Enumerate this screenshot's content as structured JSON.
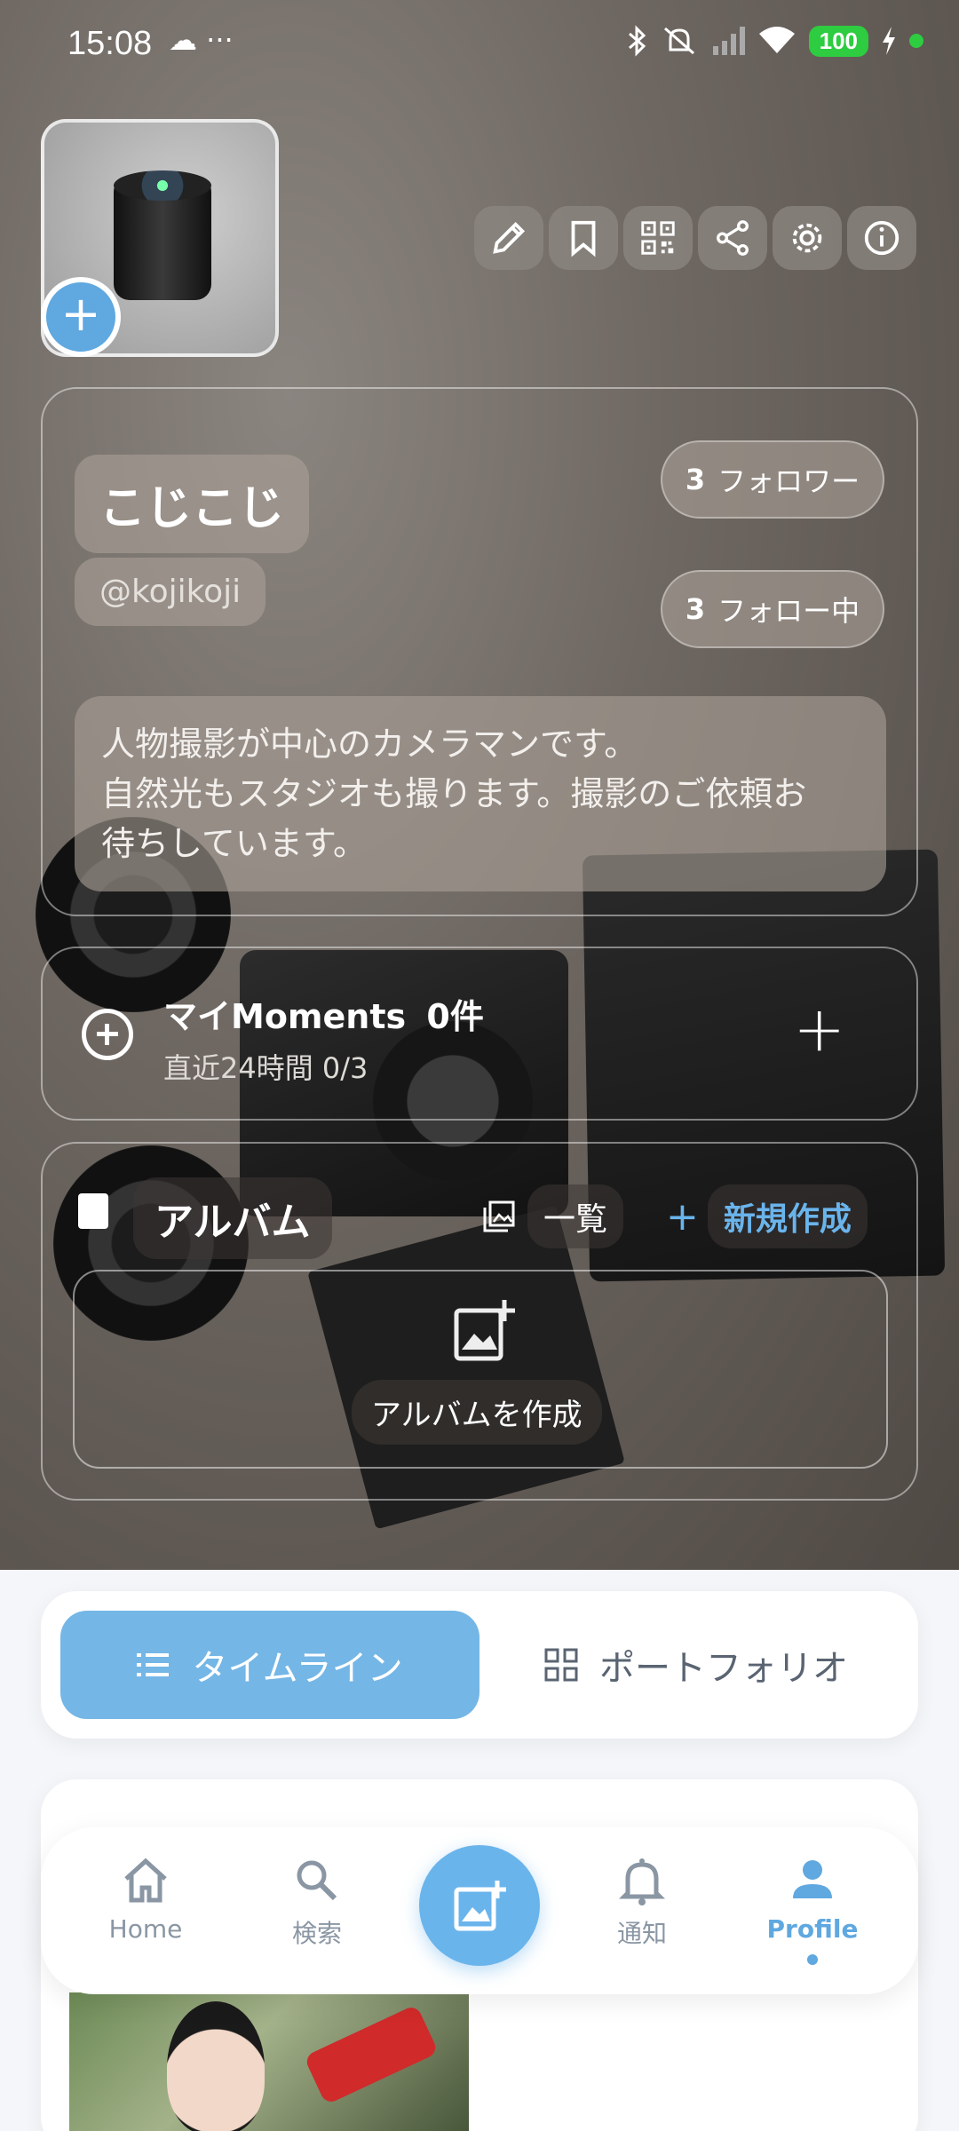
{
  "status_bar": {
    "time": "15:08",
    "left_icons": "☁ ···",
    "battery": "100",
    "icons": [
      "bluetooth-icon",
      "mute-icon",
      "signal-icon",
      "wifi-icon",
      "charging-icon"
    ]
  },
  "profile": {
    "display_name": "こじこじ",
    "handle": "@kojikoji",
    "followers_count": "3",
    "followers_label": "フォロワー",
    "following_count": "3",
    "following_label": "フォロー中",
    "bio_lines": [
      "人物撮影が中心のカメラマンです。",
      "自然光もスタジオも撮ります。撮影のご依頼お",
      "待ちしています。"
    ]
  },
  "actions": [
    "edit-icon",
    "bookmark-icon",
    "qr-code-icon",
    "share-icon",
    "settings-icon",
    "info-icon"
  ],
  "moments": {
    "title": "マイMoments",
    "count": "0件",
    "subtitle": "直近24時間 0/3"
  },
  "album": {
    "title": "アルバム",
    "list_label": "一覧",
    "new_label": "新規作成",
    "create_label": "アルバムを作成"
  },
  "tabs": {
    "timeline": "タイムライン",
    "portfolio": "ポートフォリオ",
    "active": "timeline"
  },
  "nav": {
    "home": "Home",
    "search": "検索",
    "notify": "通知",
    "profile": "Profile",
    "active": "profile"
  },
  "colors": {
    "accent": "#6ab4ec",
    "tab_active": "#74b6e6",
    "battery": "#2ecc40"
  }
}
